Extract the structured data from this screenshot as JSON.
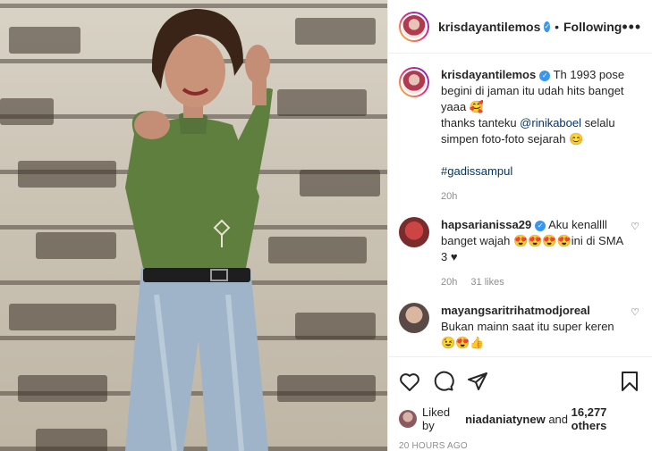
{
  "post": {
    "author": "krisdayantilemos",
    "follow_state": "Following",
    "caption_username": "krisdayantilemos",
    "caption_line1": "Th 1993 pose begini di jaman itu udah hits banget yaaa 🥰",
    "caption_line2_prefix": "thanks tanteku ",
    "caption_mention": "@rinikaboel",
    "caption_line2_suffix": " selalu simpen foto-foto sejarah 😊",
    "caption_hashtag": "#gadissampul",
    "caption_age": "20h"
  },
  "comments": [
    {
      "username": "hapsarianissa29",
      "text": "Aku kenallll banget wajah 😍😍😍😍ini di SMA 3 ♥",
      "age": "20h",
      "likes": "31 likes"
    },
    {
      "username": "mayangsaritrihatmodjoreal",
      "text": "Bukan mainn saat itu super keren 😉😍👍"
    }
  ],
  "footer": {
    "liked_prefix": "Liked by ",
    "liked_user": "niadaniatynew",
    "liked_mid": " and ",
    "liked_count": "16,277 others",
    "timestamp": "20 HOURS AGO"
  },
  "icons": {
    "like": "heart-icon",
    "comment": "comment-icon",
    "share": "share-icon",
    "save": "bookmark-icon",
    "more": "more-options-icon",
    "verified": "verified-badge-icon"
  },
  "colors": {
    "link": "#00376b",
    "verified": "#3897f0",
    "muted": "#8e8e8e",
    "text": "#262626"
  }
}
